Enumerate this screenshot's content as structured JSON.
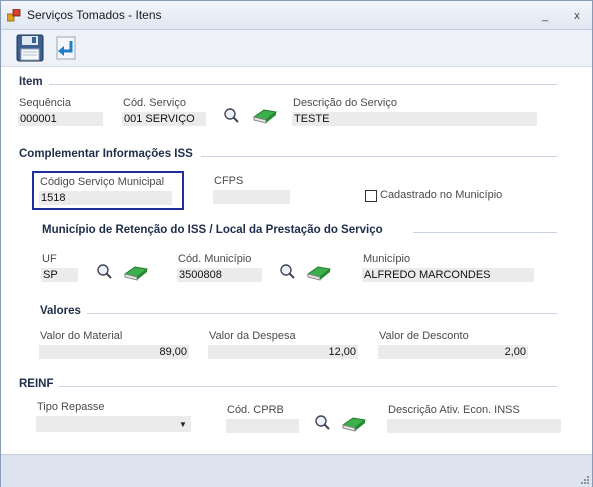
{
  "window": {
    "title": "Serviços Tomados - Itens",
    "minimize": "_",
    "close": "x"
  },
  "sections": {
    "item": "Item",
    "complementar": "Complementar Informações ISS",
    "municipio": "Município de Retenção do ISS / Local da Prestação  do Serviço",
    "valores": "Valores",
    "reinf": "REINF"
  },
  "item": {
    "sequencia_label": "Sequência",
    "sequencia_value": "000001",
    "cod_servico_label": "Cód. Serviço",
    "cod_servico_value": "001 SERVIÇO",
    "descricao_label": "Descrição do Serviço",
    "descricao_value": "TESTE"
  },
  "complementar": {
    "codigo_label": "Código Serviço Municipal",
    "codigo_value": "1518",
    "cfps_label": "CFPS",
    "cfps_value": "",
    "cadastrado_label": "Cadastrado no Município",
    "cadastrado_checked": false
  },
  "municipio": {
    "uf_label": "UF",
    "uf_value": "SP",
    "cod_label": "Cód. Município",
    "cod_value": "3500808",
    "mun_label": "Município",
    "mun_value": "ALFREDO MARCONDES"
  },
  "valores": {
    "material_label": "Valor do Material",
    "material_value": "89,00",
    "despesa_label": "Valor da Despesa",
    "despesa_value": "12,00",
    "desconto_label": "Valor de Desconto",
    "desconto_value": "2,00"
  },
  "reinf": {
    "tipo_label": "Tipo Repasse",
    "tipo_value": "",
    "cprb_label": "Cód. CPRB",
    "cprb_value": "",
    "desc_label": "Descrição Ativ. Econ. INSS",
    "desc_value": ""
  },
  "icons": {
    "save": "floppy-disk-icon",
    "back": "return-arrow-icon",
    "search": "magnifier-icon",
    "clear": "eraser-icon"
  },
  "colors": {
    "highlight": "#1e2f9a",
    "eraser": "#3cb04a"
  }
}
